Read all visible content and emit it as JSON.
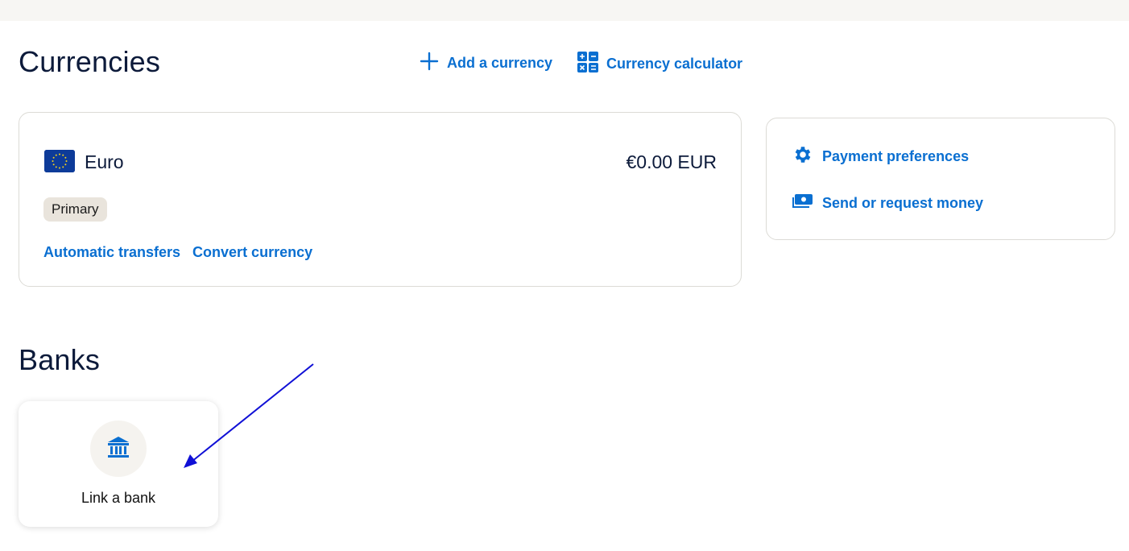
{
  "currencies": {
    "title": "Currencies",
    "add_currency": "Add a currency",
    "currency_calculator": "Currency calculator",
    "account": {
      "name": "Euro",
      "balance": "€0.00 EUR",
      "badge": "Primary",
      "links": [
        "Automatic transfers",
        "Convert currency"
      ]
    }
  },
  "sidebar": {
    "payment_preferences": "Payment preferences",
    "send_or_request": "Send or request money"
  },
  "banks": {
    "title": "Banks",
    "link_bank": "Link a bank"
  },
  "colors": {
    "accent": "#0a6fd1",
    "annotation_arrow": "#1010d6"
  }
}
